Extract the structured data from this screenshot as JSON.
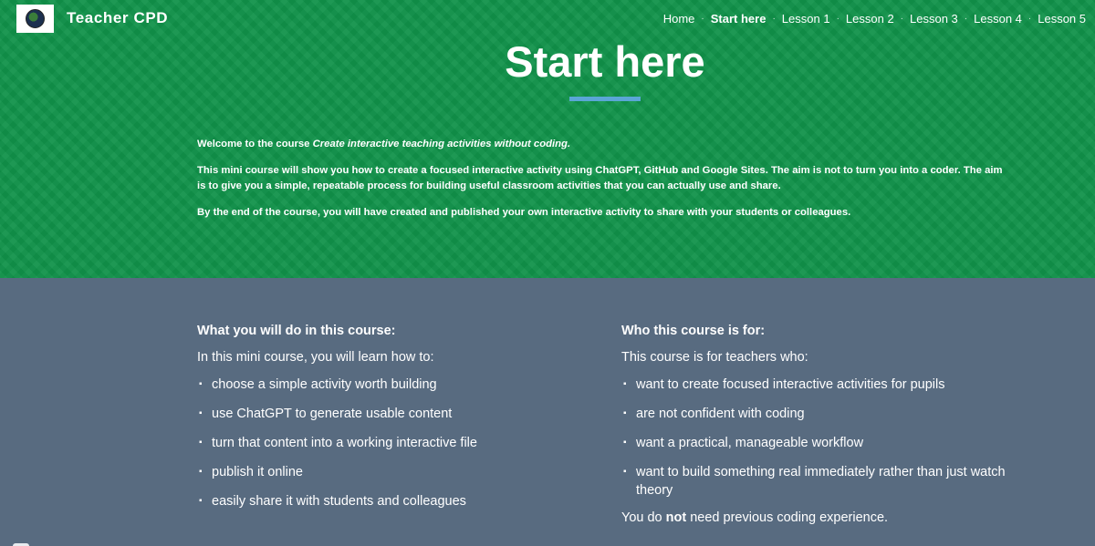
{
  "header": {
    "site_title": "Teacher CPD",
    "logo_icon": "globe-icon",
    "nav": [
      {
        "label": "Home",
        "active": false
      },
      {
        "label": "Start here",
        "active": true
      },
      {
        "label": "Lesson 1",
        "active": false
      },
      {
        "label": "Lesson 2",
        "active": false
      },
      {
        "label": "Lesson 3",
        "active": false
      },
      {
        "label": "Lesson 4",
        "active": false
      },
      {
        "label": "Lesson 5",
        "active": false
      }
    ]
  },
  "hero": {
    "title": "Start here",
    "intro_prefix": "Welcome to the course ",
    "course_name": "Create interactive teaching activities without coding.",
    "paragraph_2": "This mini course will show you how to create a focused interactive activity using ChatGPT, GitHub and Google Sites. The aim is not to turn you into a coder. The aim is to give you a simple, repeatable process for building useful classroom activities that you can actually use and share.",
    "paragraph_3": "By the end of the course, you will have created and published your own interactive activity to share with your students or colleagues."
  },
  "left_column": {
    "heading": "What you will do in this course:",
    "lead": "In this mini course, you will learn how to:",
    "items": [
      "choose a simple activity worth building",
      "use ChatGPT to generate usable content",
      "turn that content into a working interactive file",
      "publish it online",
      "easily share it with students and colleagues"
    ]
  },
  "right_column": {
    "heading": "Who this course is for:",
    "lead": "This course is for teachers who:",
    "items": [
      "want to create focused interactive activities for pupils",
      "are not confident with coding",
      "want a practical, manageable workflow",
      "want to build something real immediately rather than just watch theory"
    ],
    "outro_before": "You do ",
    "outro_emphasis": "not",
    "outro_after": " need previous coding experience."
  },
  "colors": {
    "hero_green": "#10924a",
    "content_slate": "#586b80",
    "underline_blue": "#5aa6d6"
  }
}
